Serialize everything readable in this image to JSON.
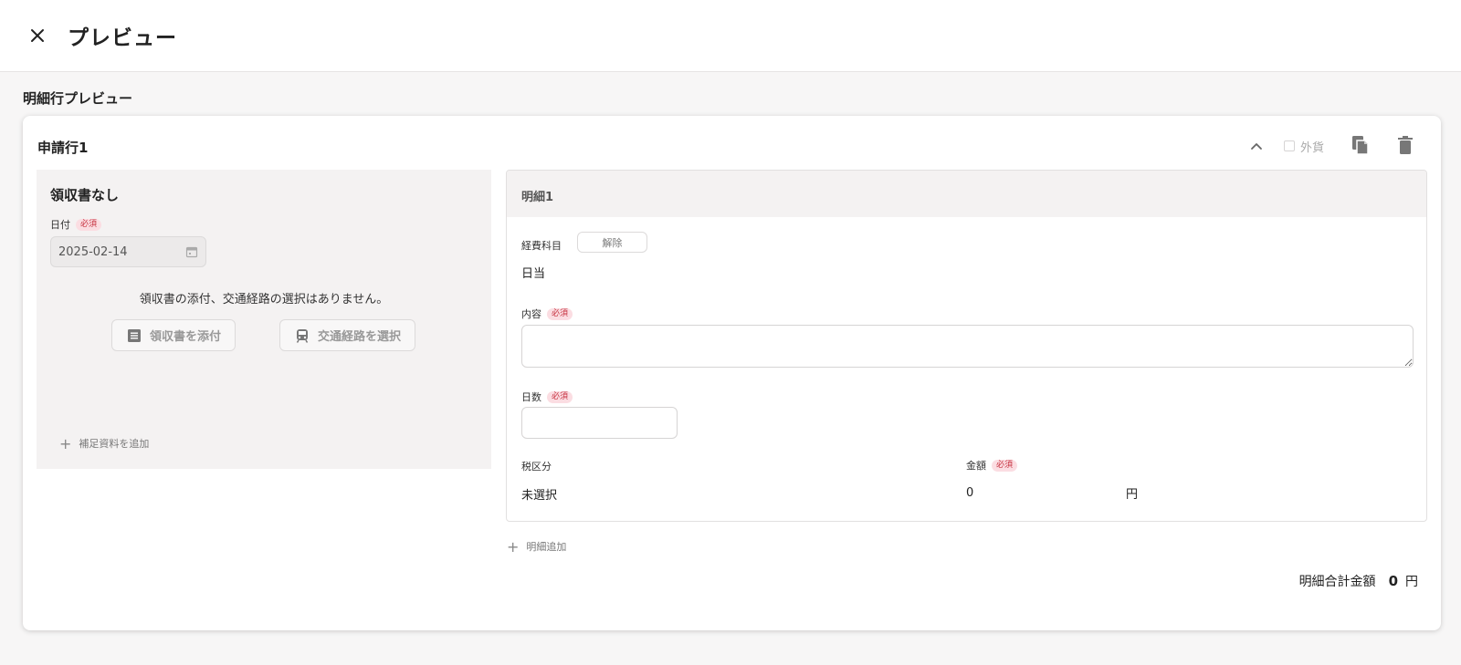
{
  "header": {
    "title": "プレビュー",
    "close_icon": "close-icon"
  },
  "section": {
    "title": "明細行プレビュー"
  },
  "line": {
    "title": "申請行1",
    "toolbar": {
      "collapse_icon": "chevron-up-icon",
      "foreign_currency_label": "外貨",
      "foreign_currency_checked": false,
      "copy_icon": "copy-icon",
      "delete_icon": "trash-icon"
    },
    "receipt": {
      "title": "領収書なし",
      "date_label": "日付",
      "required_badge": "必須",
      "date_value": "2025-02-14",
      "no_attachment_text": "領収書の添付、交通経路の選択はありません。",
      "attach_receipt_label": "領収書を添付",
      "select_route_label": "交通経路を選択",
      "add_supplement_label": "補足資料を追加"
    },
    "detail": {
      "title": "明細1",
      "account_label": "経費科目",
      "clear_label": "解除",
      "account_value": "日当",
      "content_label": "内容",
      "content_value": "",
      "days_label": "日数",
      "days_value": "",
      "tax_label": "税区分",
      "tax_value": "未選択",
      "amount_label": "金額",
      "amount_value": "0",
      "amount_unit": "円",
      "required_badge": "必須"
    },
    "add_detail_label": "明細追加",
    "total": {
      "label": "明細合計金額",
      "value": "0",
      "unit": "円"
    }
  },
  "colors": {
    "required_bg": "#fbdde2",
    "required_text": "#c6303e",
    "panel_bg": "#f4f2f2"
  }
}
